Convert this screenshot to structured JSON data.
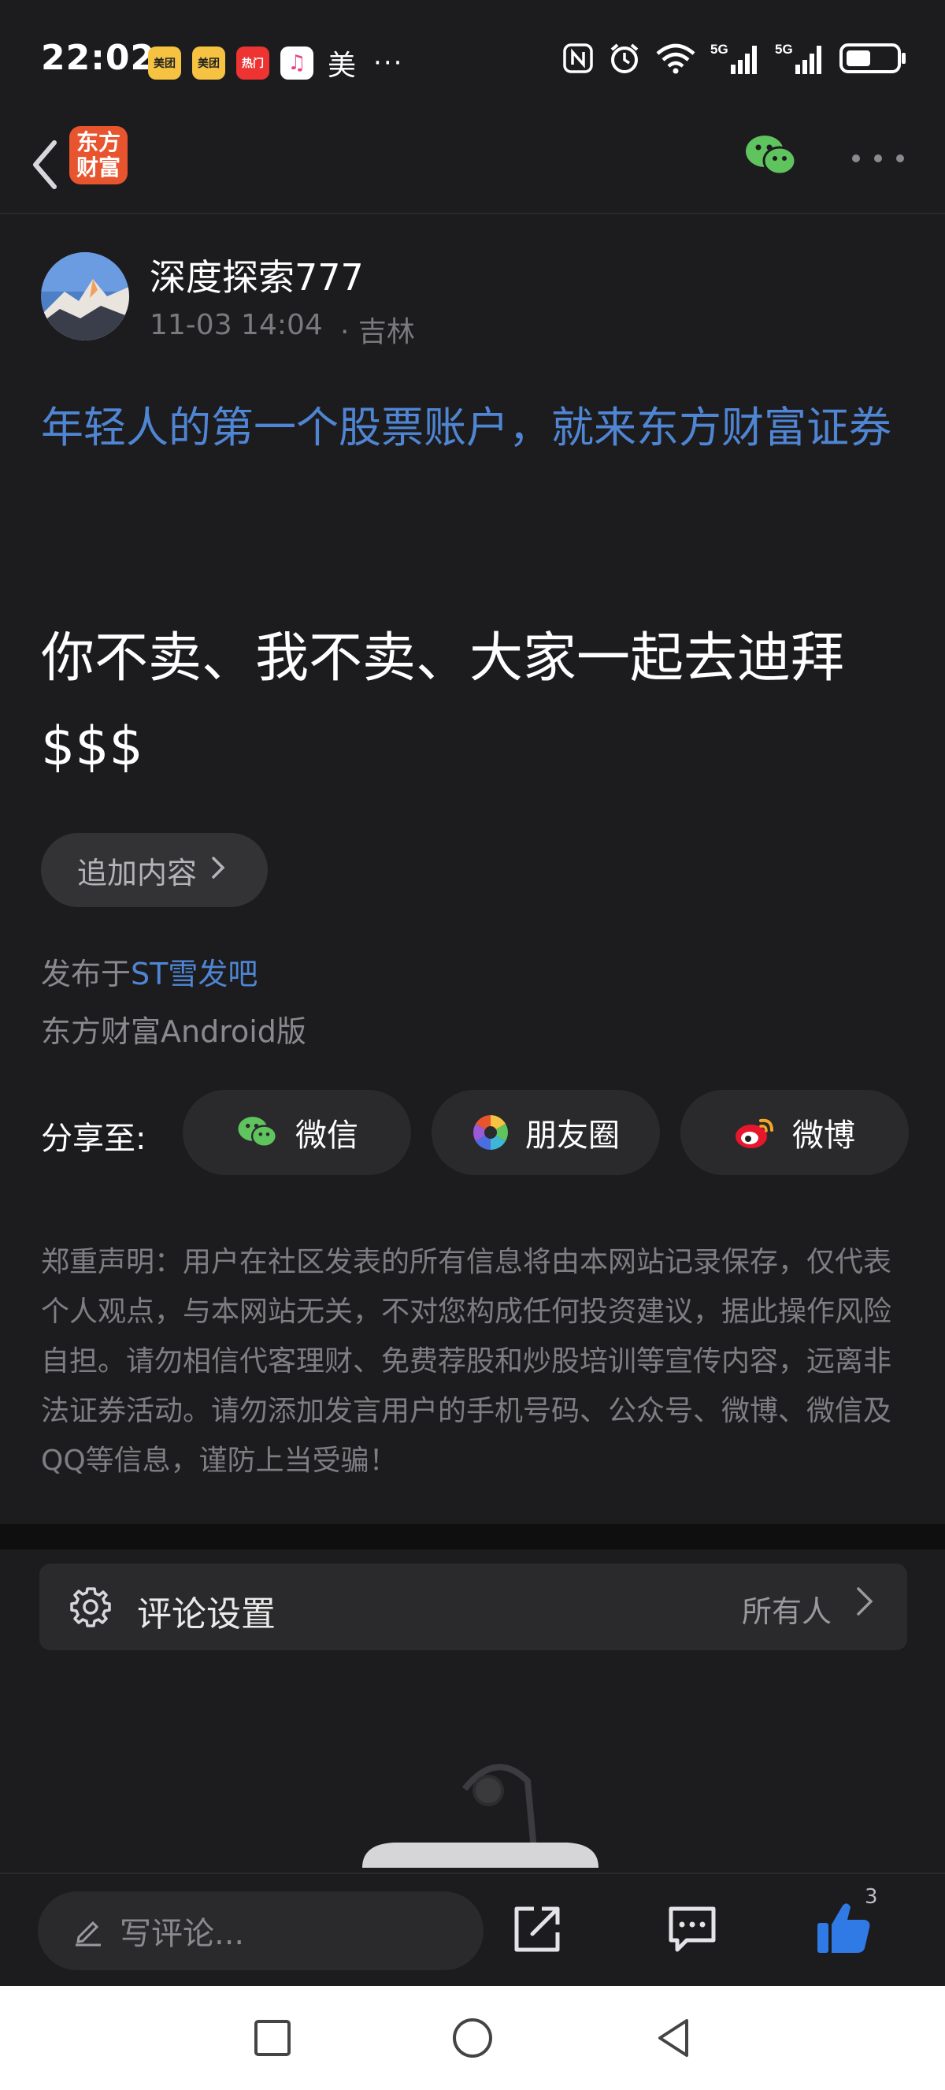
{
  "status_bar": {
    "time": "22:02",
    "apps": [
      {
        "icon": "meituan-icon",
        "label": "美团"
      },
      {
        "icon": "meituan-icon",
        "label": "美团"
      },
      {
        "icon": "video-app-icon",
        "label": "热门"
      },
      {
        "icon": "music-icon",
        "label": "♫"
      }
    ],
    "extra_text": "美",
    "more": "···",
    "right_icons": [
      "nfc-icon",
      "alarm-icon",
      "wifi-icon",
      "signal-5g-icon",
      "signal-5g-icon",
      "battery-icon"
    ],
    "network_1": "5G",
    "network_2": "5G"
  },
  "nav": {
    "logo_line1": "东方",
    "logo_line2": "财富",
    "logo_color": "#e8542e"
  },
  "post": {
    "author": "深度探索777",
    "time": "11-03 14:04",
    "location": "· 吉林",
    "promo": "年轻人的第一个股票账户，就来东方财富证券",
    "body": "你不卖、我不卖、大家一起去迪拜$$$",
    "append_label": "追加内容",
    "published_prefix": "发布于",
    "published_bar": "ST雪发吧",
    "client": "东方财富Android版"
  },
  "share": {
    "label": "分享至:",
    "wechat": "微信",
    "moments": "朋友圈",
    "weibo": "微博"
  },
  "disclaimer": "郑重声明：用户在社区发表的所有信息将由本网站记录保存，仅代表个人观点，与本网站无关，不对您构成任何投资建议，据此操作风险自担。请勿相信代客理财、免费荐股和炒股培训等宣传内容，远离非法证券活动。请勿添加发言用户的手机号码、公众号、微博、微信及QQ等信息，谨防上当受骗！",
  "comment_settings": {
    "label": "评论设置",
    "value": "所有人"
  },
  "toolbar": {
    "comment_placeholder": "写评论...",
    "like_count": "3"
  },
  "colors": {
    "background": "#1c1c1e",
    "link_blue": "#4f85d3",
    "like_blue": "#2f7ae5",
    "wechat_green": "#5fc35e"
  }
}
